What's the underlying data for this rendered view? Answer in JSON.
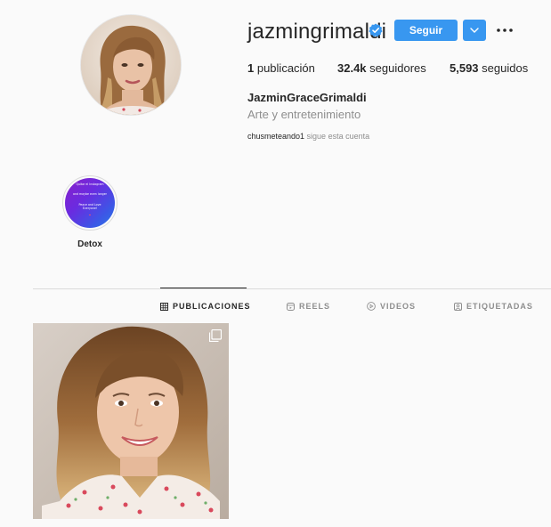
{
  "profile": {
    "username": "jazmingrimaldi",
    "verified": true,
    "follow_label": "Seguir",
    "stats": {
      "posts_count": "1",
      "posts_label": " publicación",
      "followers_count": "32.4k",
      "followers_label": " seguidores",
      "following_count": "5,593",
      "following_label": " seguidos"
    },
    "full_name": "JazminGraceGrimaldi",
    "category": "Arte y entretenimiento",
    "followed_by_user": "chusmeteando1",
    "followed_by_text": " sigue esta cuenta"
  },
  "highlights": [
    {
      "label": "Detox",
      "cover_lines": [
        "Quitar el Instagram",
        "and maybe even longer",
        "Peace and Love Everyone!"
      ]
    }
  ],
  "tabs": [
    {
      "label": "PUBLICACIONES",
      "icon": "grid-icon",
      "active": true
    },
    {
      "label": "REELS",
      "icon": "reels-icon",
      "active": false
    },
    {
      "label": "VIDEOS",
      "icon": "play-icon",
      "active": false
    },
    {
      "label": "ETIQUETADAS",
      "icon": "tagged-icon",
      "active": false
    }
  ],
  "posts": [
    {
      "type": "carousel",
      "icon": "multiple-posts-icon"
    }
  ],
  "colors": {
    "accent": "#3897f0",
    "background": "#fafafa",
    "text": "#262626",
    "muted": "#8e8e8e",
    "border": "#dbdbdb"
  }
}
